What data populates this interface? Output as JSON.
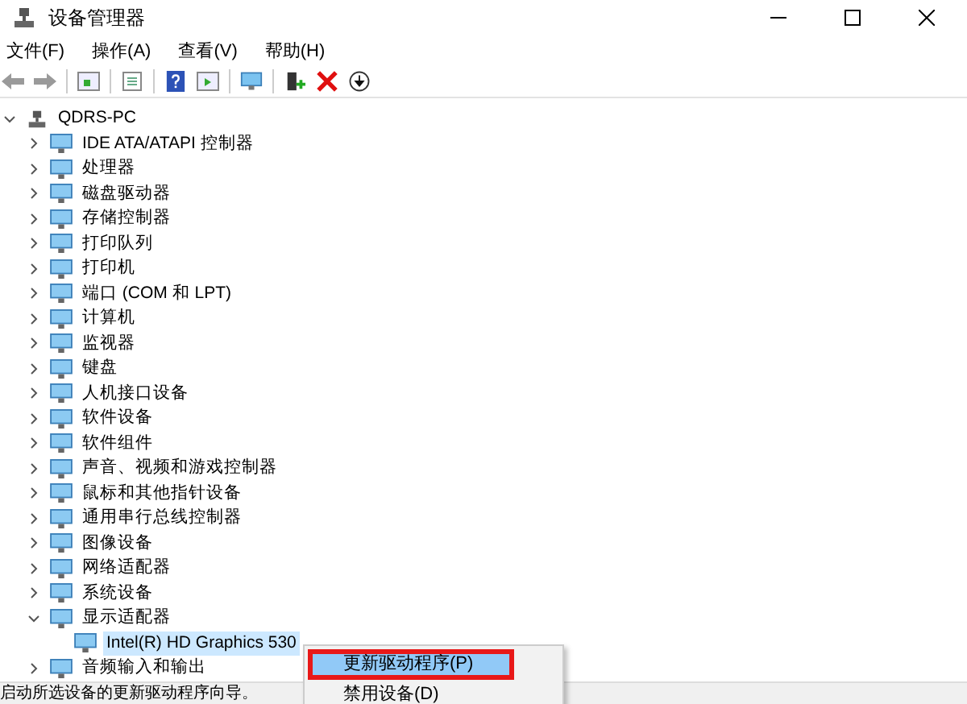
{
  "window": {
    "title": "设备管理器"
  },
  "menu_bar": [
    "文件(F)",
    "操作(A)",
    "查看(V)",
    "帮助(H)"
  ],
  "tree": [
    {
      "label": "QDRS-PC",
      "expanded": true,
      "selected": false,
      "children": [
        {
          "label": "IDE ATA/ATAPI 控制器",
          "expanded": false,
          "selected": false
        },
        {
          "label": "处理器",
          "expanded": false,
          "selected": false
        },
        {
          "label": "磁盘驱动器",
          "expanded": false,
          "selected": false
        },
        {
          "label": "存储控制器",
          "expanded": false,
          "selected": false
        },
        {
          "label": "打印队列",
          "expanded": false,
          "selected": false
        },
        {
          "label": "打印机",
          "expanded": false,
          "selected": false
        },
        {
          "label": "端口 (COM 和 LPT)",
          "expanded": false,
          "selected": false
        },
        {
          "label": "计算机",
          "expanded": false,
          "selected": false
        },
        {
          "label": "监视器",
          "expanded": false,
          "selected": false
        },
        {
          "label": "键盘",
          "expanded": false,
          "selected": false
        },
        {
          "label": "人机接口设备",
          "expanded": false,
          "selected": false
        },
        {
          "label": "软件设备",
          "expanded": false,
          "selected": false
        },
        {
          "label": "软件组件",
          "expanded": false,
          "selected": false
        },
        {
          "label": "声音、视频和游戏控制器",
          "expanded": false,
          "selected": false
        },
        {
          "label": "鼠标和其他指针设备",
          "expanded": false,
          "selected": false
        },
        {
          "label": "通用串行总线控制器",
          "expanded": false,
          "selected": false
        },
        {
          "label": "图像设备",
          "expanded": false,
          "selected": false
        },
        {
          "label": "网络适配器",
          "expanded": false,
          "selected": false
        },
        {
          "label": "系统设备",
          "expanded": false,
          "selected": false
        },
        {
          "label": "显示适配器",
          "expanded": true,
          "selected": false,
          "children": [
            {
              "label": "Intel(R) HD Graphics 530",
              "selected": true
            }
          ]
        },
        {
          "label": "音频输入和输出",
          "expanded": false,
          "selected": false
        }
      ]
    }
  ],
  "context_menu": [
    {
      "label": "更新驱动程序(P)",
      "selected": true,
      "annotated": true
    },
    {
      "label": "禁用设备(D)",
      "selected": false,
      "annotated": false
    }
  ],
  "status_bar": "启动所选设备的更新驱动程序向导。"
}
